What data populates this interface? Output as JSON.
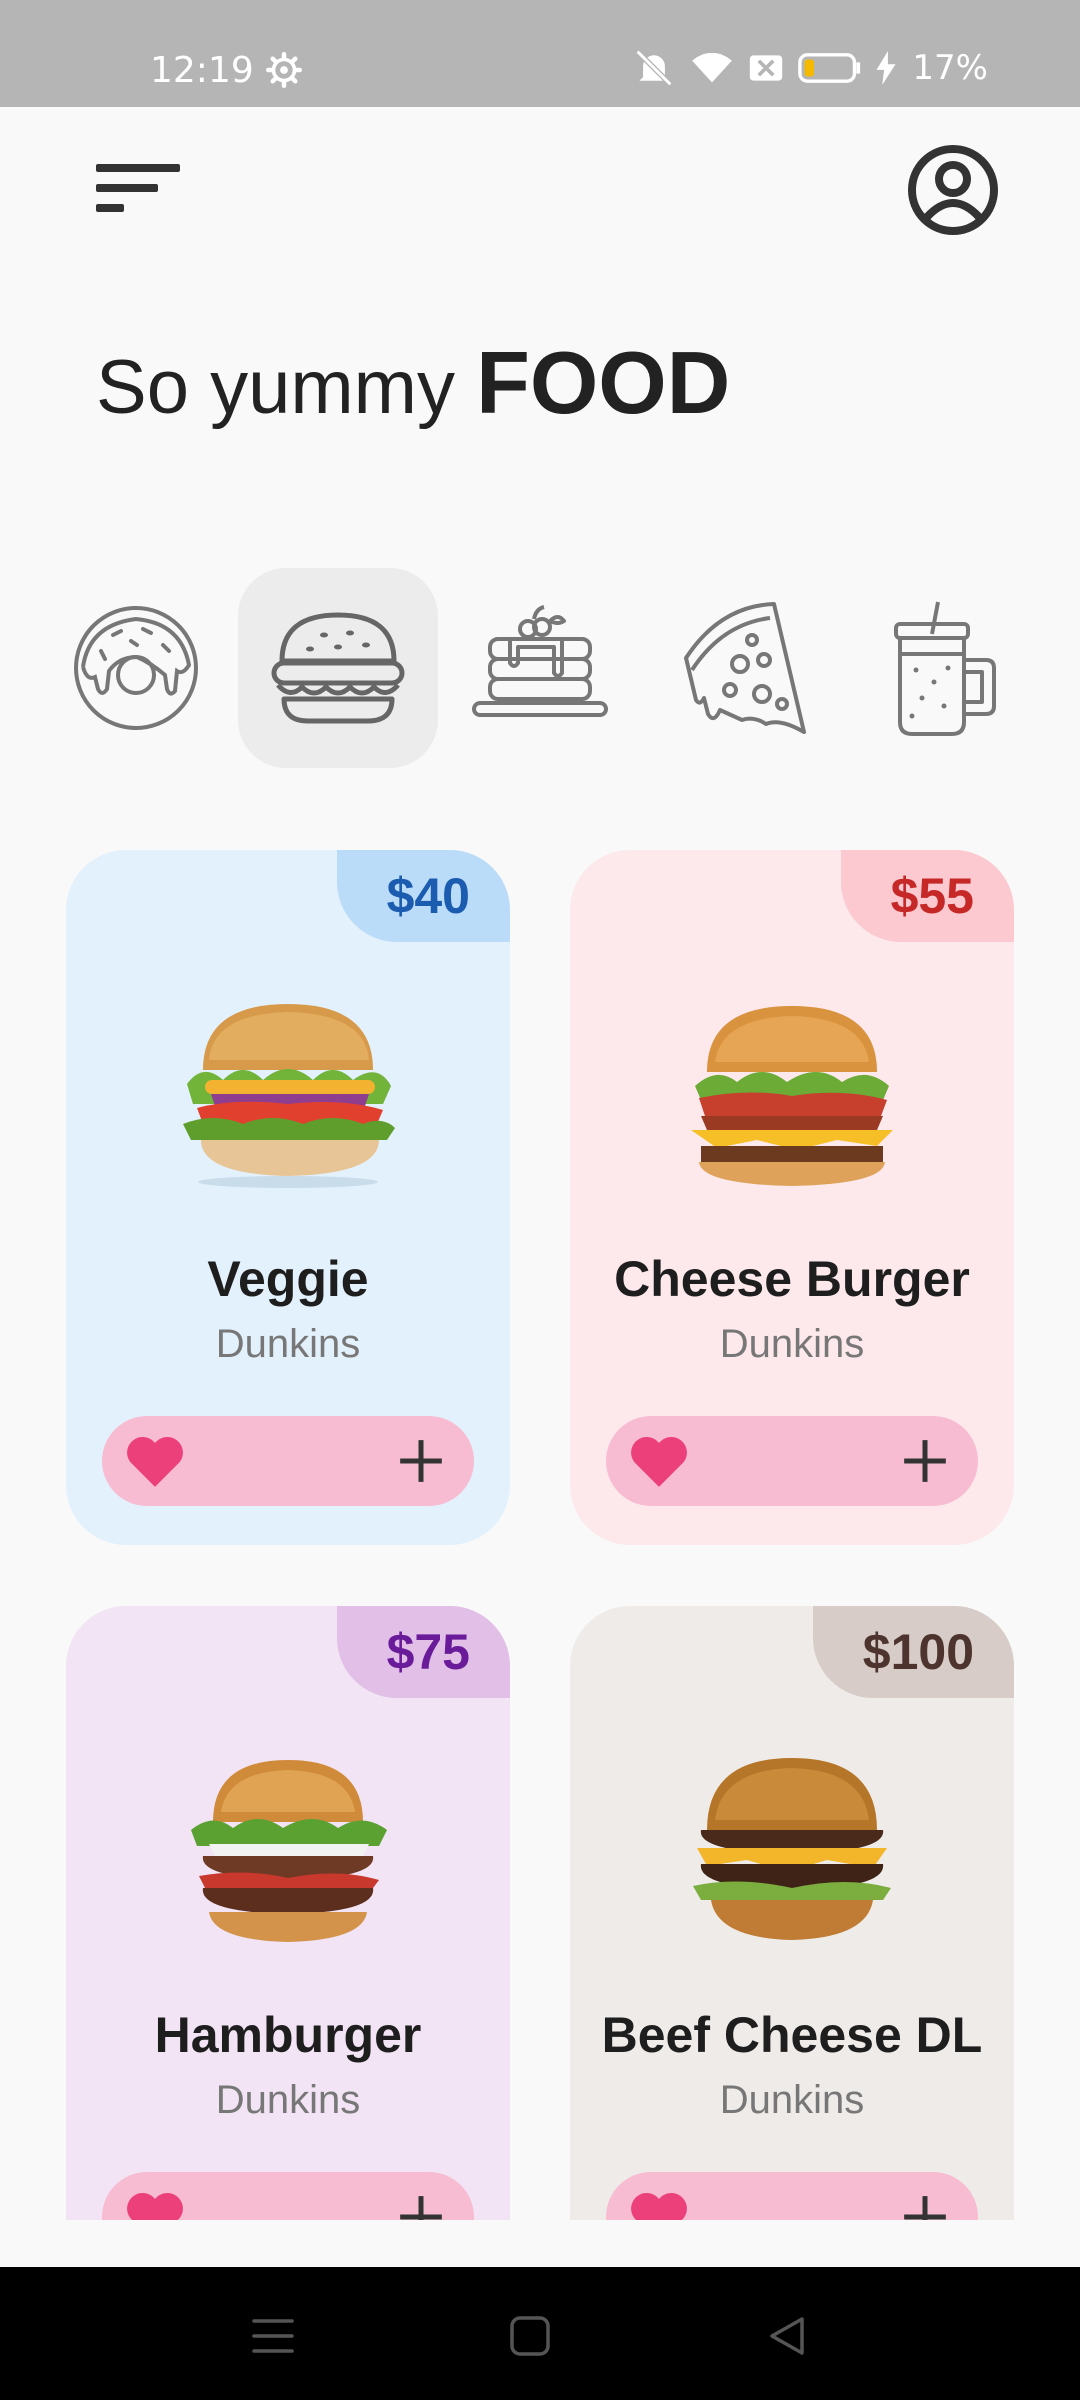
{
  "status_bar": {
    "time": "12:19",
    "battery_percent": "17%",
    "icons": [
      "settings-gear-icon",
      "mute-icon",
      "wifi-icon",
      "no-sim-icon",
      "battery-icon",
      "charging-bolt-icon"
    ]
  },
  "header": {
    "menu_icon": "menu-lines-icon",
    "profile_icon": "user-circle-icon",
    "headline_light": "So yummy",
    "headline_bold": "FOOD"
  },
  "categories": [
    {
      "icon": "donut-icon",
      "selected": false
    },
    {
      "icon": "burger-icon",
      "selected": true
    },
    {
      "icon": "pancakes-icon",
      "selected": false
    },
    {
      "icon": "pizza-icon",
      "selected": false
    },
    {
      "icon": "drink-jar-icon",
      "selected": false
    }
  ],
  "products": [
    {
      "name": "Veggie",
      "brand": "Dunkins",
      "price": "$40",
      "card_color": "#e3f1fd",
      "tag_color": "#bbdcf8",
      "price_color": "#1c5cb0"
    },
    {
      "name": "Cheese Burger",
      "brand": "Dunkins",
      "price": "$55",
      "card_color": "#fde9ec",
      "tag_color": "#fcc9d0",
      "price_color": "#c62828"
    },
    {
      "name": "Hamburger",
      "brand": "Dunkins",
      "price": "$75",
      "card_color": "#f2e4f4",
      "tag_color": "#e1bfe7",
      "price_color": "#6a1b9a"
    },
    {
      "name": "Beef Cheese DL",
      "brand": "Dunkins",
      "price": "$100",
      "card_color": "#efebe9",
      "tag_color": "#d7ccc8",
      "price_color": "#4e342e"
    }
  ],
  "colors": {
    "background": "#f9f9f9",
    "action_bar": "#f7bcd1",
    "heart": "#ec407a"
  },
  "nav": {
    "icons": [
      "recents-menu-icon",
      "home-square-icon",
      "back-triangle-icon"
    ]
  }
}
